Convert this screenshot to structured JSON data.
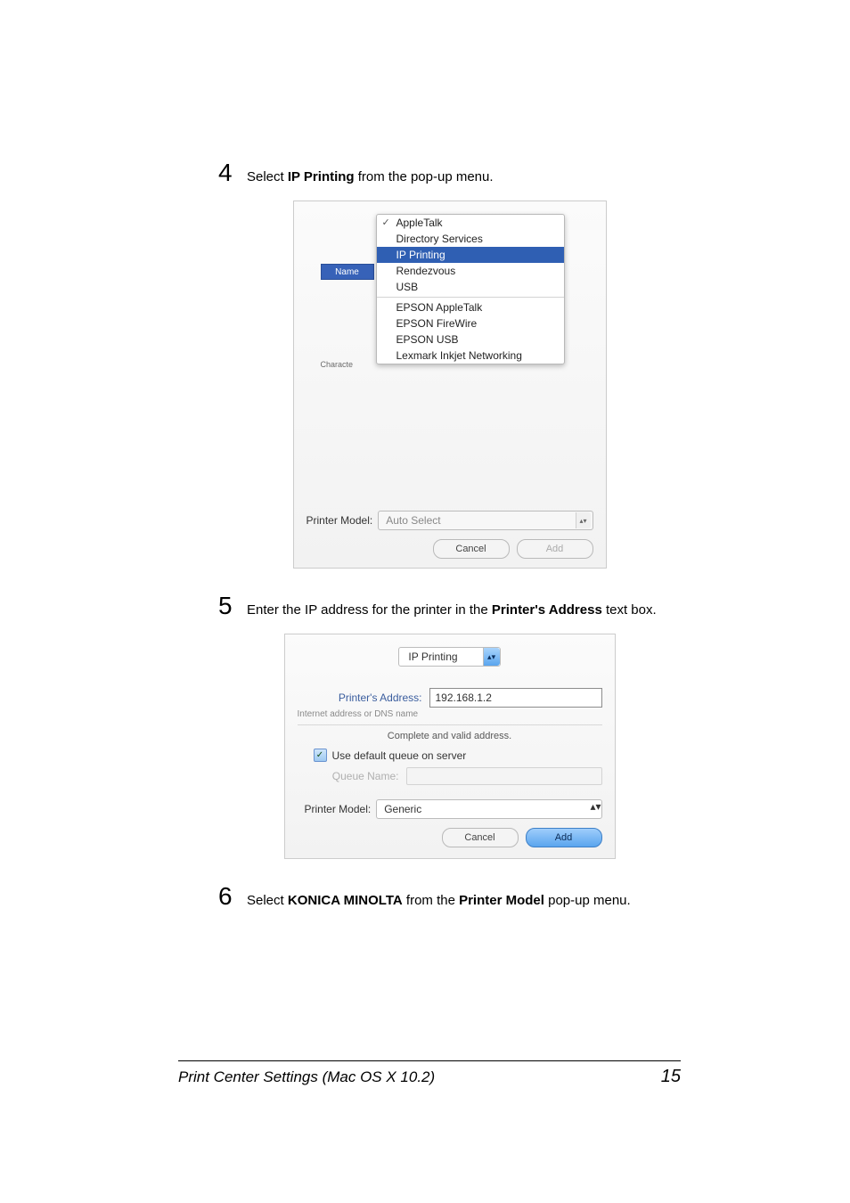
{
  "step4": {
    "num": "4",
    "pre": "Select ",
    "bold": "IP Printing",
    "post": " from the pop-up menu."
  },
  "shot1": {
    "menu": {
      "appletalk": "AppleTalk",
      "dirserv": "Directory Services",
      "ipprinting": "IP Printing",
      "rendezvous": "Rendezvous",
      "usb": "USB",
      "eps_at": "EPSON AppleTalk",
      "eps_fw": "EPSON FireWire",
      "eps_usb": "EPSON USB",
      "lexmark": "Lexmark Inkjet Networking"
    },
    "name_header": "Name",
    "character_label": "Characte",
    "printer_model_label": "Printer Model:",
    "printer_model_value": "Auto Select",
    "cancel": "Cancel",
    "add": "Add"
  },
  "step5": {
    "num": "5",
    "pre": "Enter the IP address for the printer in the ",
    "bold": "Printer's Address",
    "post": " text box."
  },
  "shot2": {
    "top_popup": "IP Printing",
    "addr_label": "Printer's Address:",
    "addr_value": "192.168.1.2",
    "addr_help": "Internet address or DNS name",
    "valid": "Complete and valid address.",
    "default_queue": "Use default queue on server",
    "queue_label": "Queue Name:",
    "printer_model_label": "Printer Model:",
    "printer_model_value": "Generic",
    "cancel": "Cancel",
    "add": "Add"
  },
  "step6": {
    "num": "6",
    "pre": "Select ",
    "bold": "KONICA MINOLTA",
    "mid": " from the ",
    "bold2": "Printer Model",
    "post": " pop-up menu."
  },
  "footer": {
    "title": "Print Center Settings (Mac OS X 10.2)",
    "page": "15"
  }
}
